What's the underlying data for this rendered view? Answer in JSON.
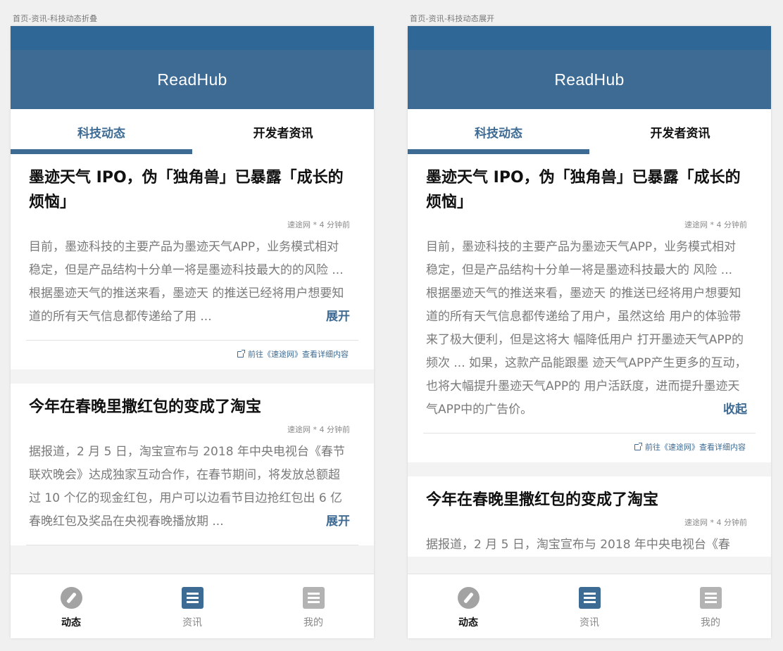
{
  "captions": {
    "left": "首页-资讯-科技动态折叠",
    "right": "首页-资讯-科技动态展开"
  },
  "app": {
    "title": "ReadHub",
    "tabs": [
      "科技动态",
      "开发者资讯"
    ],
    "nav": [
      "动态",
      "资讯",
      "我的"
    ]
  },
  "colors": {
    "status_bar": "#2f6797",
    "header": "#3d6b93",
    "accent": "#3d6b93"
  },
  "icons": {
    "nav": [
      "compass-icon",
      "list-icon",
      "list-icon"
    ],
    "source_link": "external-link-icon"
  },
  "collapsed": {
    "card1": {
      "title": "墨迹天气 IPO，伪「独角兽」已暴露「成长的烦恼」",
      "meta": "速途网 * 4 分钟前",
      "summary": "目前，墨迹科技的主要产品为墨迹天气APP，业务模式相对稳定，但是产品结构十分单一将是墨迹科技最大的的风险 ... 根据墨迹天气的推送来看，墨迹天  的推送已经将用户想要知道的所有天气信息都传递给了用 ...",
      "toggle": "展开",
      "source": "前往《速途网》查看详细内容"
    },
    "card2": {
      "title": "今年在春晚里撒红包的变成了淘宝",
      "meta": "速途网 * 4 分钟前",
      "summary": "据报道，2 月 5 日，淘宝宣布与 2018 年中央电视台《春节联欢晚会》达成独家互动合作，在春节期间，将发放总额超过 10 个亿的现金红包，用户可以边看节目边抢红包出 6 亿春晚红包及奖品在央视春晚播放期 ...",
      "toggle": "展开"
    }
  },
  "expanded": {
    "card1": {
      "title": "墨迹天气 IPO，伪「独角兽」已暴露「成长的烦恼」",
      "meta": "速途网 * 4 分钟前",
      "summary": "目前，墨迹科技的主要产品为墨迹天气APP，业务模式相对稳定，但是产品结构十分单一将是墨迹科技最大的 风险 ... 根据墨迹天气的推送来看，墨迹天  的推送已经将用户想要知道的所有天气信息都传递给了用户，虽然这给  用户的体验带来了极大便利，但是这将大  幅降低用户   打开墨迹天气APP的频次 ... 如果，这款产品能跟墨 迹天气APP产生更多的互动，也将大幅提升墨迹天气APP的  用户活跃度，进而提升墨迹天气APP中的广告价。",
      "toggle": "收起",
      "source": "前往《速途网》查看详细内容"
    },
    "card2": {
      "title": "今年在春晚里撒红包的变成了淘宝",
      "meta": "速途网 * 4 分钟前",
      "summary": "据报道，2 月 5 日，淘宝宣布与 2018 年中央电视台《春"
    }
  }
}
